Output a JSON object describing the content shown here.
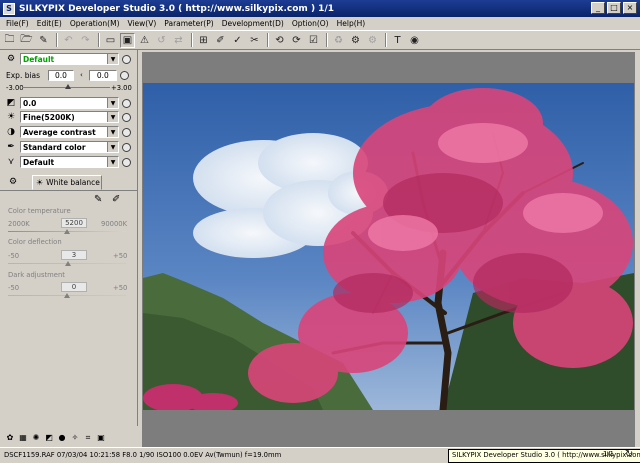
{
  "window": {
    "title": "SILKYPIX Developer Studio 3.0 ( http://www.silkypix.com )   1/1",
    "minimize": "_",
    "maximize": "□",
    "close": "×"
  },
  "menu": [
    "File(F)",
    "Edit(E)",
    "Operation(M)",
    "View(V)",
    "Parameter(P)",
    "Development(D)",
    "Option(O)",
    "Help(H)"
  ],
  "toolbar_icons": [
    "open-folder-icon",
    "open-folder-arrow-icon",
    "save-icon",
    "undo-icon",
    "redo-icon",
    "single-view-icon",
    "compare-view-icon",
    "warning-icon",
    "rotate-icon",
    "flip-icon",
    "grid-icon",
    "edit-icon",
    "check-edit-icon",
    "brush-icon",
    "rotate-left-icon",
    "rotate-right-icon",
    "checkbox-icon",
    "refresh-icon",
    "develop-icon",
    "batch-icon",
    "hammer-icon",
    "settings-icon"
  ],
  "panel": {
    "taste": "Default",
    "exposure": {
      "label": "Exp. bias",
      "value1": "0.0",
      "value2": "0.0",
      "min": "-3.00",
      "max": "+3.00"
    },
    "gradation": "0.0",
    "white_balance_mode": "Fine(5200K)",
    "contrast": "Average contrast",
    "color": "Standard color",
    "sharpness": "Default"
  },
  "wb_tab": {
    "label": "White balance",
    "color_temperature": {
      "label": "Color temperature",
      "min": "2000K",
      "value": "5200",
      "max": "90000K"
    },
    "color_deflection": {
      "label": "Color deflection",
      "min": "-50",
      "value": "3",
      "max": "+50"
    },
    "dark_adjustment": {
      "label": "Dark adjustment",
      "min": "-50",
      "value": "0",
      "max": "+50"
    }
  },
  "status": {
    "info": "DSCF1159.RAF 07/03/04 10:21:58 F8.0 1/90 ISO100  0.0EV Av(Twmun) f=19.0mm",
    "tooltip": "SILKYPIX Developer Studio 3.0 ( http://www.silkypix.com )",
    "page": "1/1"
  }
}
